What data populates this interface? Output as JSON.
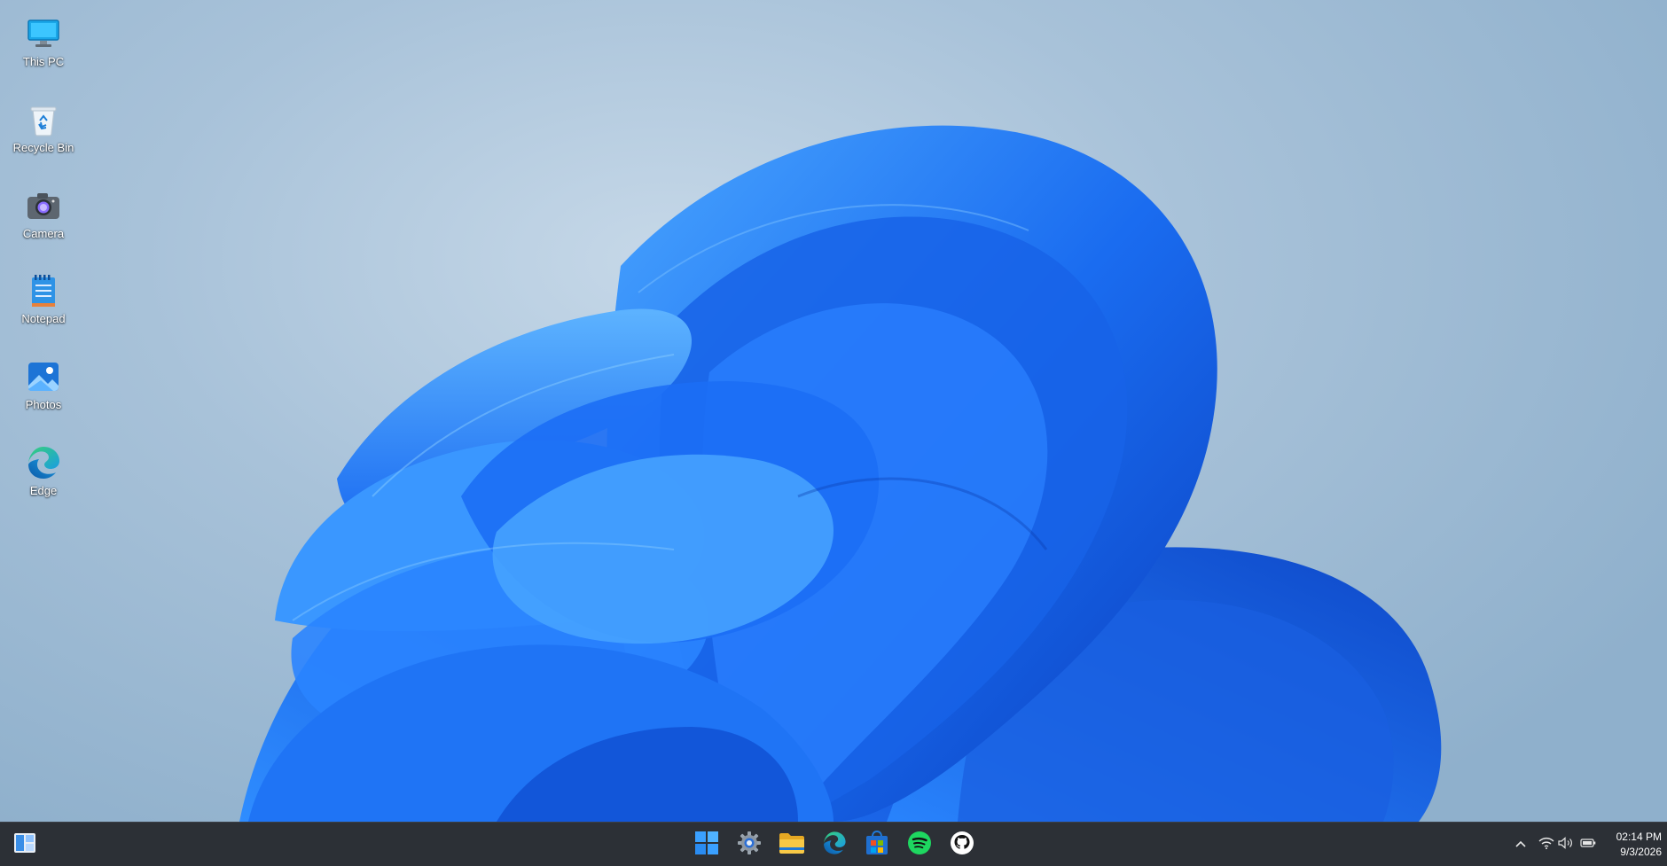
{
  "desktop": {
    "icons": [
      {
        "label": "This PC",
        "icon": "monitor-icon"
      },
      {
        "label": "Recycle Bin",
        "icon": "recycle-bin-icon"
      },
      {
        "label": "Camera",
        "icon": "camera-icon"
      },
      {
        "label": "Notepad",
        "icon": "notepad-icon"
      },
      {
        "label": "Photos",
        "icon": "photos-icon"
      },
      {
        "label": "Edge",
        "icon": "edge-icon"
      }
    ],
    "wallpaper": "windows-bloom",
    "colors": {
      "bloom": "#1a6cf0",
      "background": "#a8c2d9"
    }
  },
  "taskbar": {
    "left_widget": "widgets-icon",
    "apps": [
      "windows-start-icon",
      "settings-icon",
      "file-explorer-icon",
      "edge-icon",
      "microsoft-store-icon",
      "spotify-icon",
      "github-icon"
    ],
    "tray": [
      "chevron-up-icon",
      "wifi-icon",
      "volume-icon",
      "battery-icon"
    ],
    "clock": {
      "time": "02:14 PM",
      "date": "9/3/2026"
    }
  }
}
